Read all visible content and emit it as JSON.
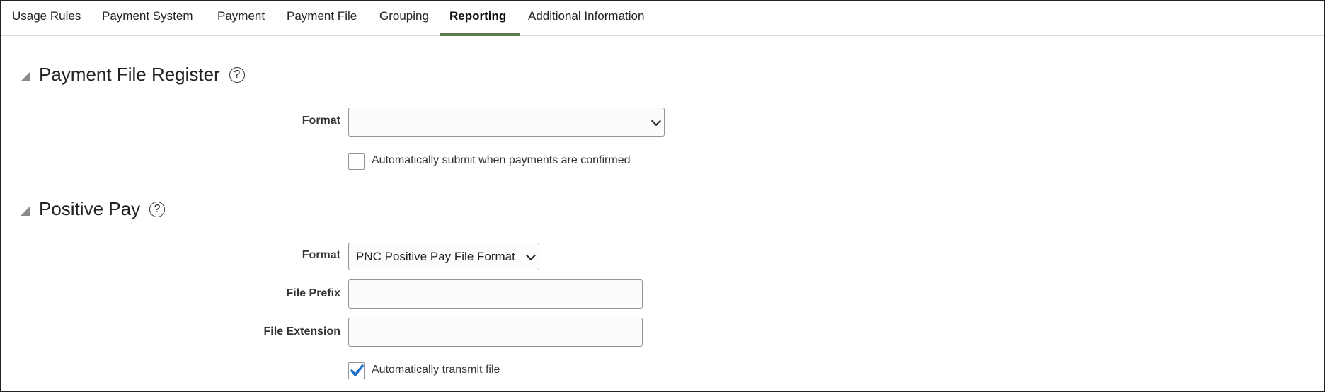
{
  "tabs": [
    {
      "label": "Usage Rules"
    },
    {
      "label": "Payment System"
    },
    {
      "label": "Payment"
    },
    {
      "label": "Payment File"
    },
    {
      "label": "Grouping"
    },
    {
      "label": "Reporting",
      "active": true
    },
    {
      "label": "Additional Information"
    }
  ],
  "accent_color": "#5b7a4f",
  "payment_file_register": {
    "title": "Payment File Register",
    "help_icon": "?",
    "format_label": "Format",
    "format_value": "",
    "auto_submit_label": "Automatically submit when payments are confirmed",
    "auto_submit_checked": false
  },
  "positive_pay": {
    "title": "Positive Pay",
    "help_icon": "?",
    "format_label": "Format",
    "format_value": "PNC Positive Pay File Format",
    "file_prefix_label": "File Prefix",
    "file_prefix_value": "",
    "file_extension_label": "File Extension",
    "file_extension_value": "",
    "auto_transmit_label": "Automatically transmit file",
    "auto_transmit_checked": true
  }
}
